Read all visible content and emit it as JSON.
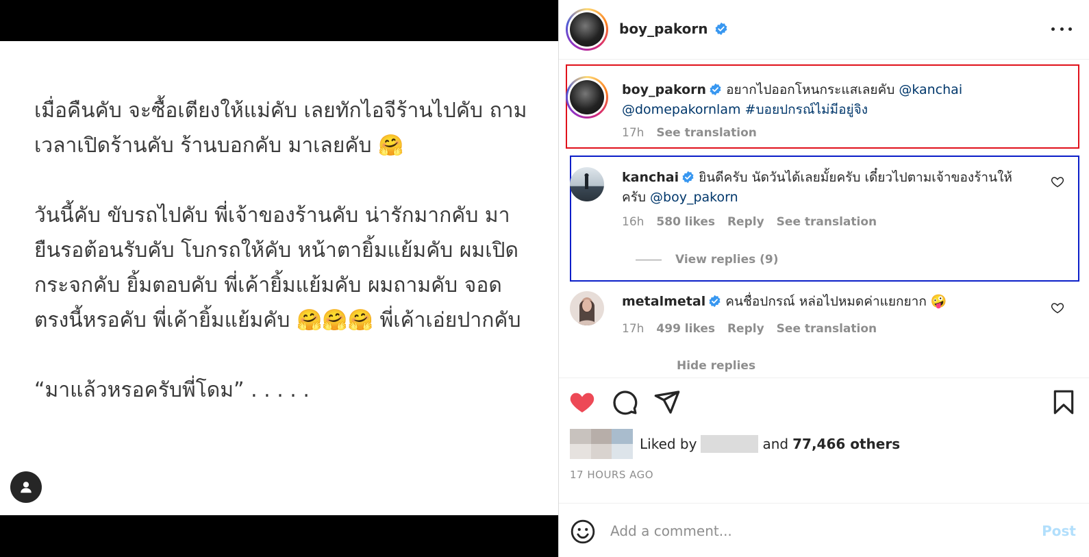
{
  "post_image": {
    "paragraphs": [
      "เมื่อคืนคับ จะซื้อเตียงให้แม่คับ เลยทักไอจีร้านไปคับ ถามเวลาเปิดร้านคับ ร้านบอกคับ มาเลยคับ 🤗",
      "วันนี้คับ ขับรถไปคับ พี่เจ้าของร้านคับ น่ารักมากคับ มายืนรอต้อนรับคับ โบกรถให้คับ หน้าตายิ้มแย้มคับ ผมเปิดกระจกคับ ยิ้มตอบคับ พี่เค้ายิ้มแย้มคับ ผมถามคับ จอดตรงนี้หรอคับ พี่เค้ายิ้มแย้มคับ 🤗🤗🤗 พี่เค้าเอ่ยปากคับ",
      "“มาแล้วหรอครับพี่โดม” . . . . ."
    ]
  },
  "header": {
    "username": "boy_pakorn"
  },
  "caption": {
    "username": "boy_pakorn",
    "text": "อยากไปออกโหนกระแสเลยคับ",
    "mention1": "@kanchai",
    "mention2": "@domepakornlam",
    "hashtag": "#บอยปกรณ์ไม่มีอยู่จิง",
    "time": "17h",
    "see_translation": "See translation"
  },
  "comments": [
    {
      "username": "kanchai",
      "text_line1": "ยินดีครับ นัดวันได้เลยมั้ยครับ เดี๋ยวไปตามเจ้าของร้านให้",
      "text_line2_prefix": "ครับ",
      "mention": "@boy_pakorn",
      "time": "16h",
      "likes": "580 likes",
      "reply": "Reply",
      "see_translation": "See translation",
      "view_replies": "View replies (9)"
    },
    {
      "username": "metalmetal",
      "text": "คนชื่อปกรณ์ หล่อไปหมดค่าแยกยาก 🤪",
      "time": "17h",
      "likes": "499 likes",
      "reply": "Reply",
      "see_translation": "See translation",
      "hide_replies": "Hide replies"
    }
  ],
  "likes": {
    "prefix": "Liked by",
    "middle": "and",
    "count": "77,466 others"
  },
  "timestamp": "17 HOURS AGO",
  "add_comment": {
    "placeholder": "Add a comment...",
    "post_label": "Post"
  },
  "colors": {
    "like_red": "#ed4956",
    "verified_blue": "#3897f0",
    "mention_blue": "#00376b",
    "highlight_red": "#e0101a",
    "highlight_blue": "#0a1ec8"
  },
  "icons": [
    "user-tag-icon",
    "verified-icon",
    "more-icon",
    "heart-filled-icon",
    "comment-icon",
    "share-icon",
    "bookmark-icon",
    "heart-outline-icon",
    "emoji-icon"
  ]
}
